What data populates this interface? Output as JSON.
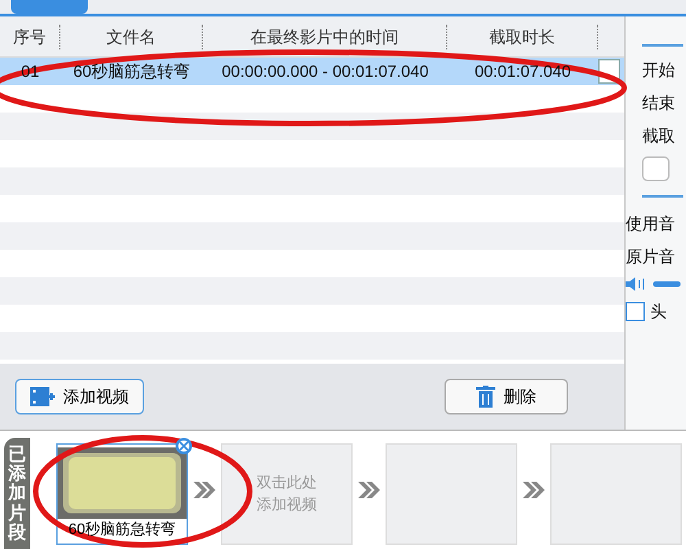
{
  "table": {
    "columns": [
      "序号",
      "文件名",
      "在最终影片中的时间",
      "截取时长"
    ],
    "rows": [
      {
        "cells": [
          "01",
          "60秒脑筋急转弯",
          "00:00:00.000 - 00:01:07.040",
          "00:01:07.040"
        ],
        "selected": true
      }
    ]
  },
  "buttons": [
    {
      "label": "添加视频",
      "kind": "add"
    },
    {
      "label": "删除",
      "kind": "delete"
    }
  ],
  "side_panel": {
    "labels": [
      "开始",
      "结束",
      "截取"
    ],
    "audio_labels": [
      "使用音",
      "原片音"
    ],
    "checkbox": {
      "label": "头",
      "checked": false
    }
  },
  "clips": {
    "title": "已添加片段",
    "items": [
      {
        "kind": "clip",
        "caption": "60秒脑筋急转弯",
        "selected": true
      },
      {
        "kind": "empty",
        "caption": "双击此处添加视频"
      },
      {
        "kind": "empty"
      },
      {
        "kind": "empty"
      }
    ]
  }
}
